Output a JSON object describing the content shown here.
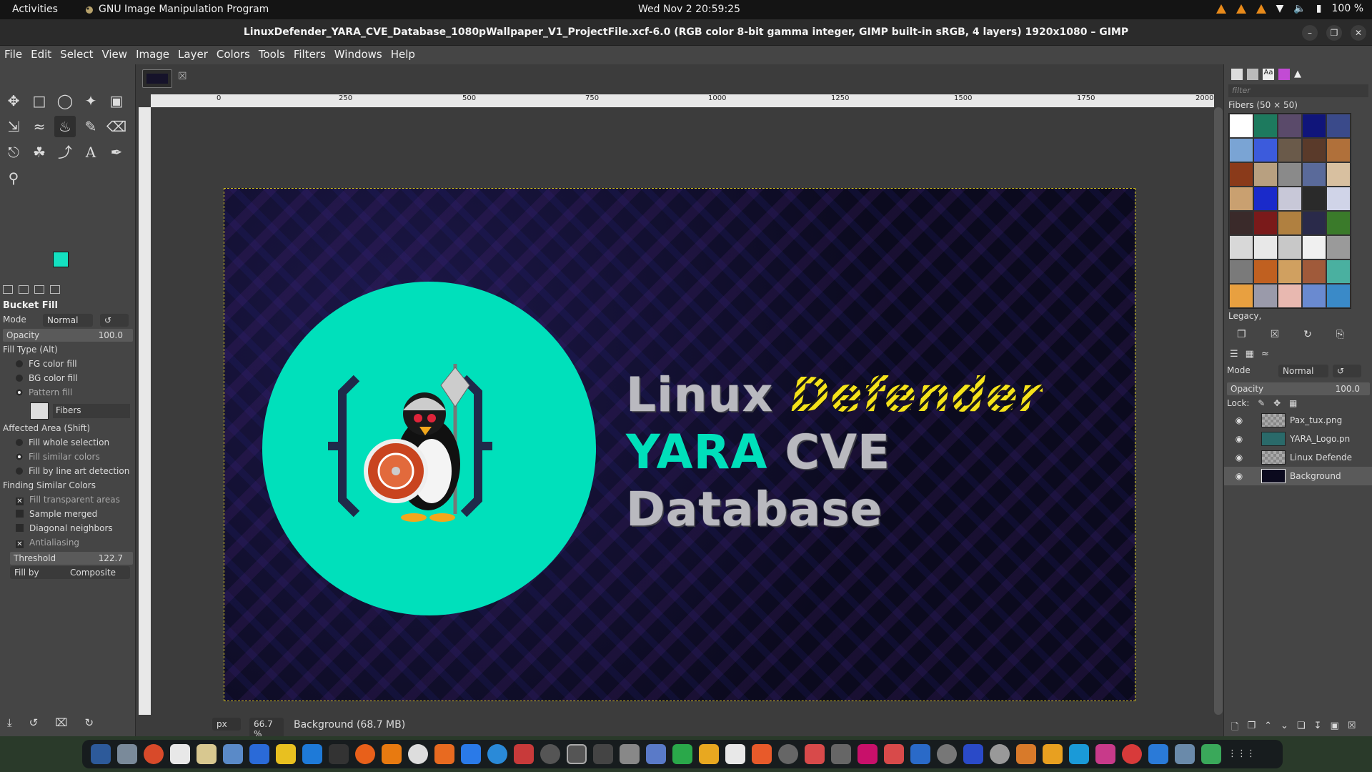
{
  "topbar": {
    "activities": "Activities",
    "app_name": "GNU Image Manipulation Program",
    "clock": "Wed Nov 2  20:59:25",
    "battery": "100 %"
  },
  "titlebar": {
    "title": "LinuxDefender_YARA_CVE_Database_1080pWallpaper_V1_ProjectFile.xcf-6.0 (RGB color 8-bit gamma integer, GIMP built-in sRGB, 4 layers) 1920x1080 – GIMP"
  },
  "menu": [
    "File",
    "Edit",
    "Select",
    "View",
    "Image",
    "Layer",
    "Colors",
    "Tools",
    "Filters",
    "Windows",
    "Help"
  ],
  "colors": {
    "fg": "#14e0c0",
    "bg": "#3b4a8c",
    "selection_marching_ants": "#d4c21b"
  },
  "tool_options": {
    "title": "Bucket Fill",
    "mode_label": "Mode",
    "mode_value": "Normal",
    "opacity_label": "Opacity",
    "opacity_value": "100.0",
    "fill_type_label": "Fill Type  (Alt)",
    "fill_types": [
      "FG color fill",
      "BG color fill",
      "Pattern fill"
    ],
    "pattern_name": "Fibers",
    "affected_area_label": "Affected Area  (Shift)",
    "affected_areas": [
      "Fill whole selection",
      "Fill similar colors",
      "Fill by line art detection"
    ],
    "finding_label": "Finding Similar Colors",
    "finding_options": [
      "Fill transparent areas",
      "Sample merged",
      "Diagonal neighbors",
      "Antialiasing"
    ],
    "threshold_label": "Threshold",
    "threshold_value": "122.7",
    "fill_by_label": "Fill by",
    "fill_by_value": "Composite"
  },
  "ruler": {
    "ticks": [
      "0",
      "250",
      "500",
      "750",
      "1000",
      "1250",
      "1500",
      "1750",
      "2000"
    ]
  },
  "canvas_text": {
    "line1a": "Linux",
    "line1b": "Defender",
    "line2a": "YARA",
    "line2b": "CVE",
    "line3": "Database"
  },
  "status": {
    "unit": "px",
    "zoom": "66.7 %",
    "info": "Background (68.7 MB)"
  },
  "patterns_panel": {
    "filter_placeholder": "filter",
    "pattern_heading": "Fibers (50 × 50)",
    "tag": "Legacy,"
  },
  "layers_panel": {
    "mode_label": "Mode",
    "mode_value": "Normal",
    "opacity_label": "Opacity",
    "opacity_value": "100.0",
    "lock_label": "Lock:",
    "layers": [
      "Pax_tux.png",
      "YARA_Logo.pn",
      "Linux Defende",
      "Background"
    ]
  }
}
